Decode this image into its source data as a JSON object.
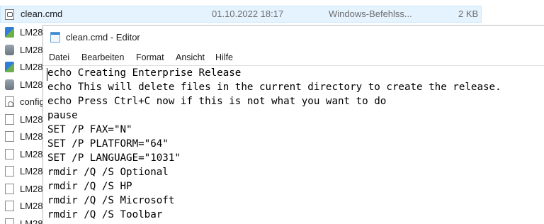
{
  "explorer": {
    "selected_file": {
      "name": "clean.cmd",
      "date": "01.10.2022 18:17",
      "type": "Windows-Befehlss...",
      "size": "2 KB"
    },
    "files": [
      {
        "name": "LM28",
        "icon": "network-setup-icon"
      },
      {
        "name": "LM28",
        "icon": "installer-icon"
      },
      {
        "name": "LM28",
        "icon": "network-setup-icon"
      },
      {
        "name": "LM28",
        "icon": "installer-icon"
      },
      {
        "name": "config",
        "icon": "config-file-icon"
      },
      {
        "name": "LM28",
        "icon": "blank-file-icon"
      },
      {
        "name": "LM28",
        "icon": "blank-file-icon"
      },
      {
        "name": "LM28",
        "icon": "blank-file-icon"
      },
      {
        "name": "LM28",
        "icon": "blank-file-icon"
      },
      {
        "name": "LM28",
        "icon": "blank-file-icon"
      },
      {
        "name": "LM28",
        "icon": "blank-file-icon"
      },
      {
        "name": "LM28",
        "icon": "blank-file-icon"
      }
    ]
  },
  "notepad": {
    "title": "clean.cmd - Editor",
    "menu": [
      "Datei",
      "Bearbeiten",
      "Format",
      "Ansicht",
      "Hilfe"
    ],
    "lines": [
      "echo Creating Enterprise Release",
      "echo This will delete files in the current directory to create the release.",
      "echo Press Ctrl+C now if this is not what you want to do",
      "pause",
      "SET /P FAX=\"N\"",
      "SET /P PLATFORM=\"64\"",
      "SET /P LANGUAGE=\"1031\"",
      "rmdir /Q /S Optional",
      "rmdir /Q /S HP",
      "rmdir /Q /S Microsoft",
      "rmdir /Q /S Toolbar"
    ]
  }
}
